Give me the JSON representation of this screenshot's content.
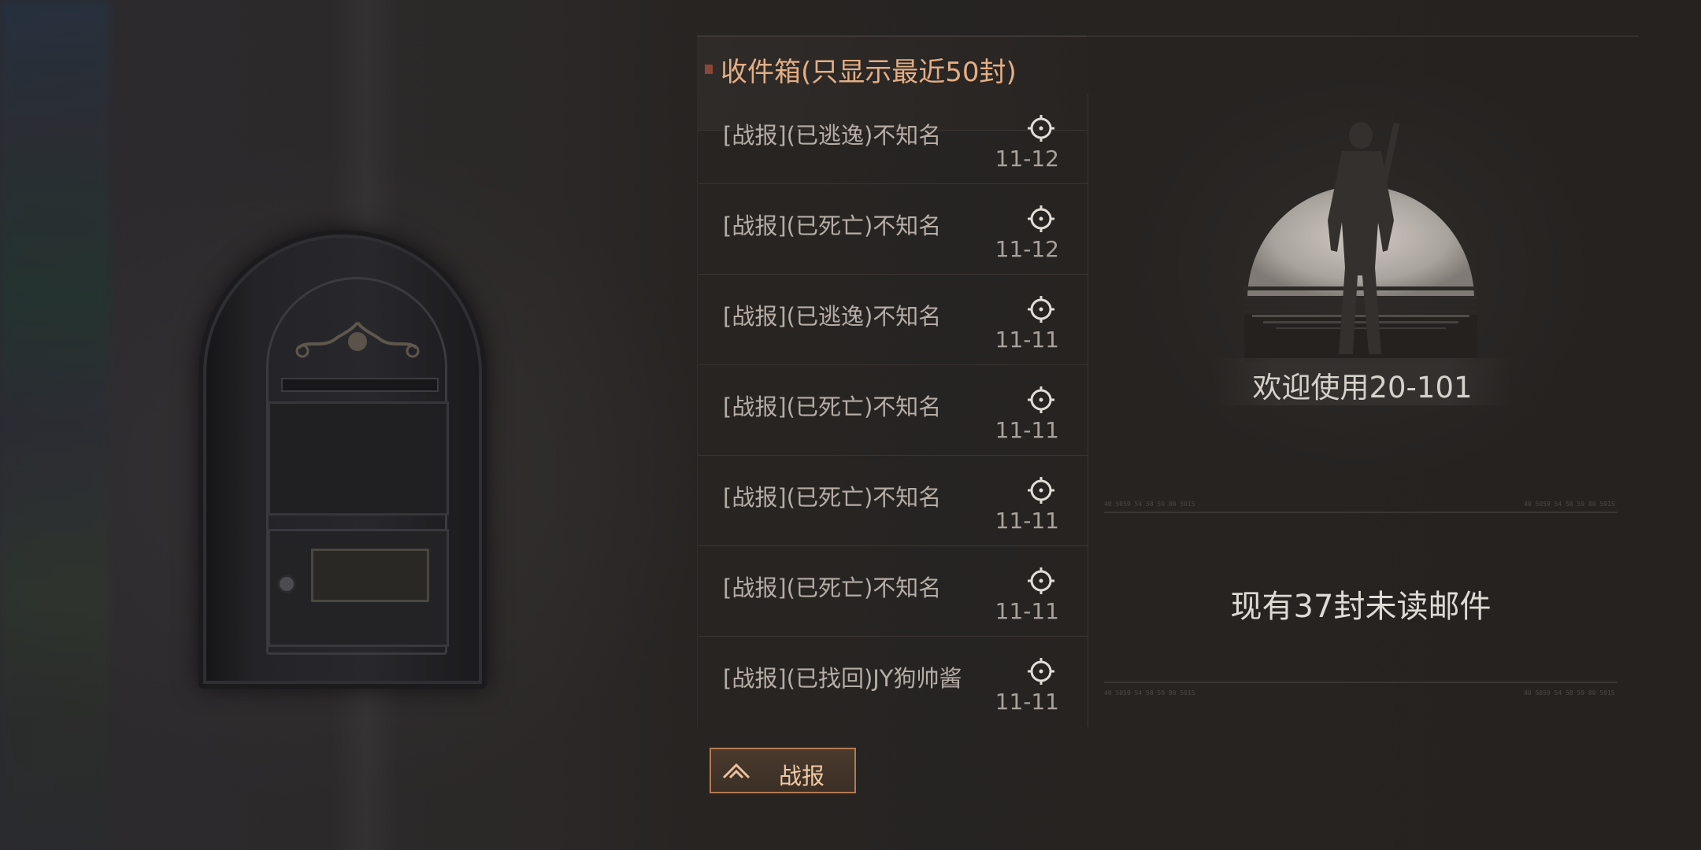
{
  "inbox": {
    "title": "收件箱(只显示最近50封)",
    "items": [
      {
        "subject": "[战报](已逃逸)不知名",
        "date": "11-12"
      },
      {
        "subject": "[战报](已死亡)不知名",
        "date": "11-12"
      },
      {
        "subject": "[战报](已逃逸)不知名",
        "date": "11-11"
      },
      {
        "subject": "[战报](已死亡)不知名",
        "date": "11-11"
      },
      {
        "subject": "[战报](已死亡)不知名",
        "date": "11-11"
      },
      {
        "subject": "[战报](已死亡)不知名",
        "date": "11-11"
      },
      {
        "subject": "[战报](已找回)JY狗帅酱",
        "date": "11-11"
      }
    ]
  },
  "filter_button": {
    "label": "战报",
    "icon": "mountain-chevron-icon"
  },
  "info": {
    "welcome": "欢迎使用20-101",
    "unread": "现有37封未读邮件",
    "divider_code": "40 5059 54 58 59 80 5915"
  },
  "colors": {
    "accent": "#e3ae85",
    "button_border": "#b37a52",
    "marker": "#8c4637"
  }
}
